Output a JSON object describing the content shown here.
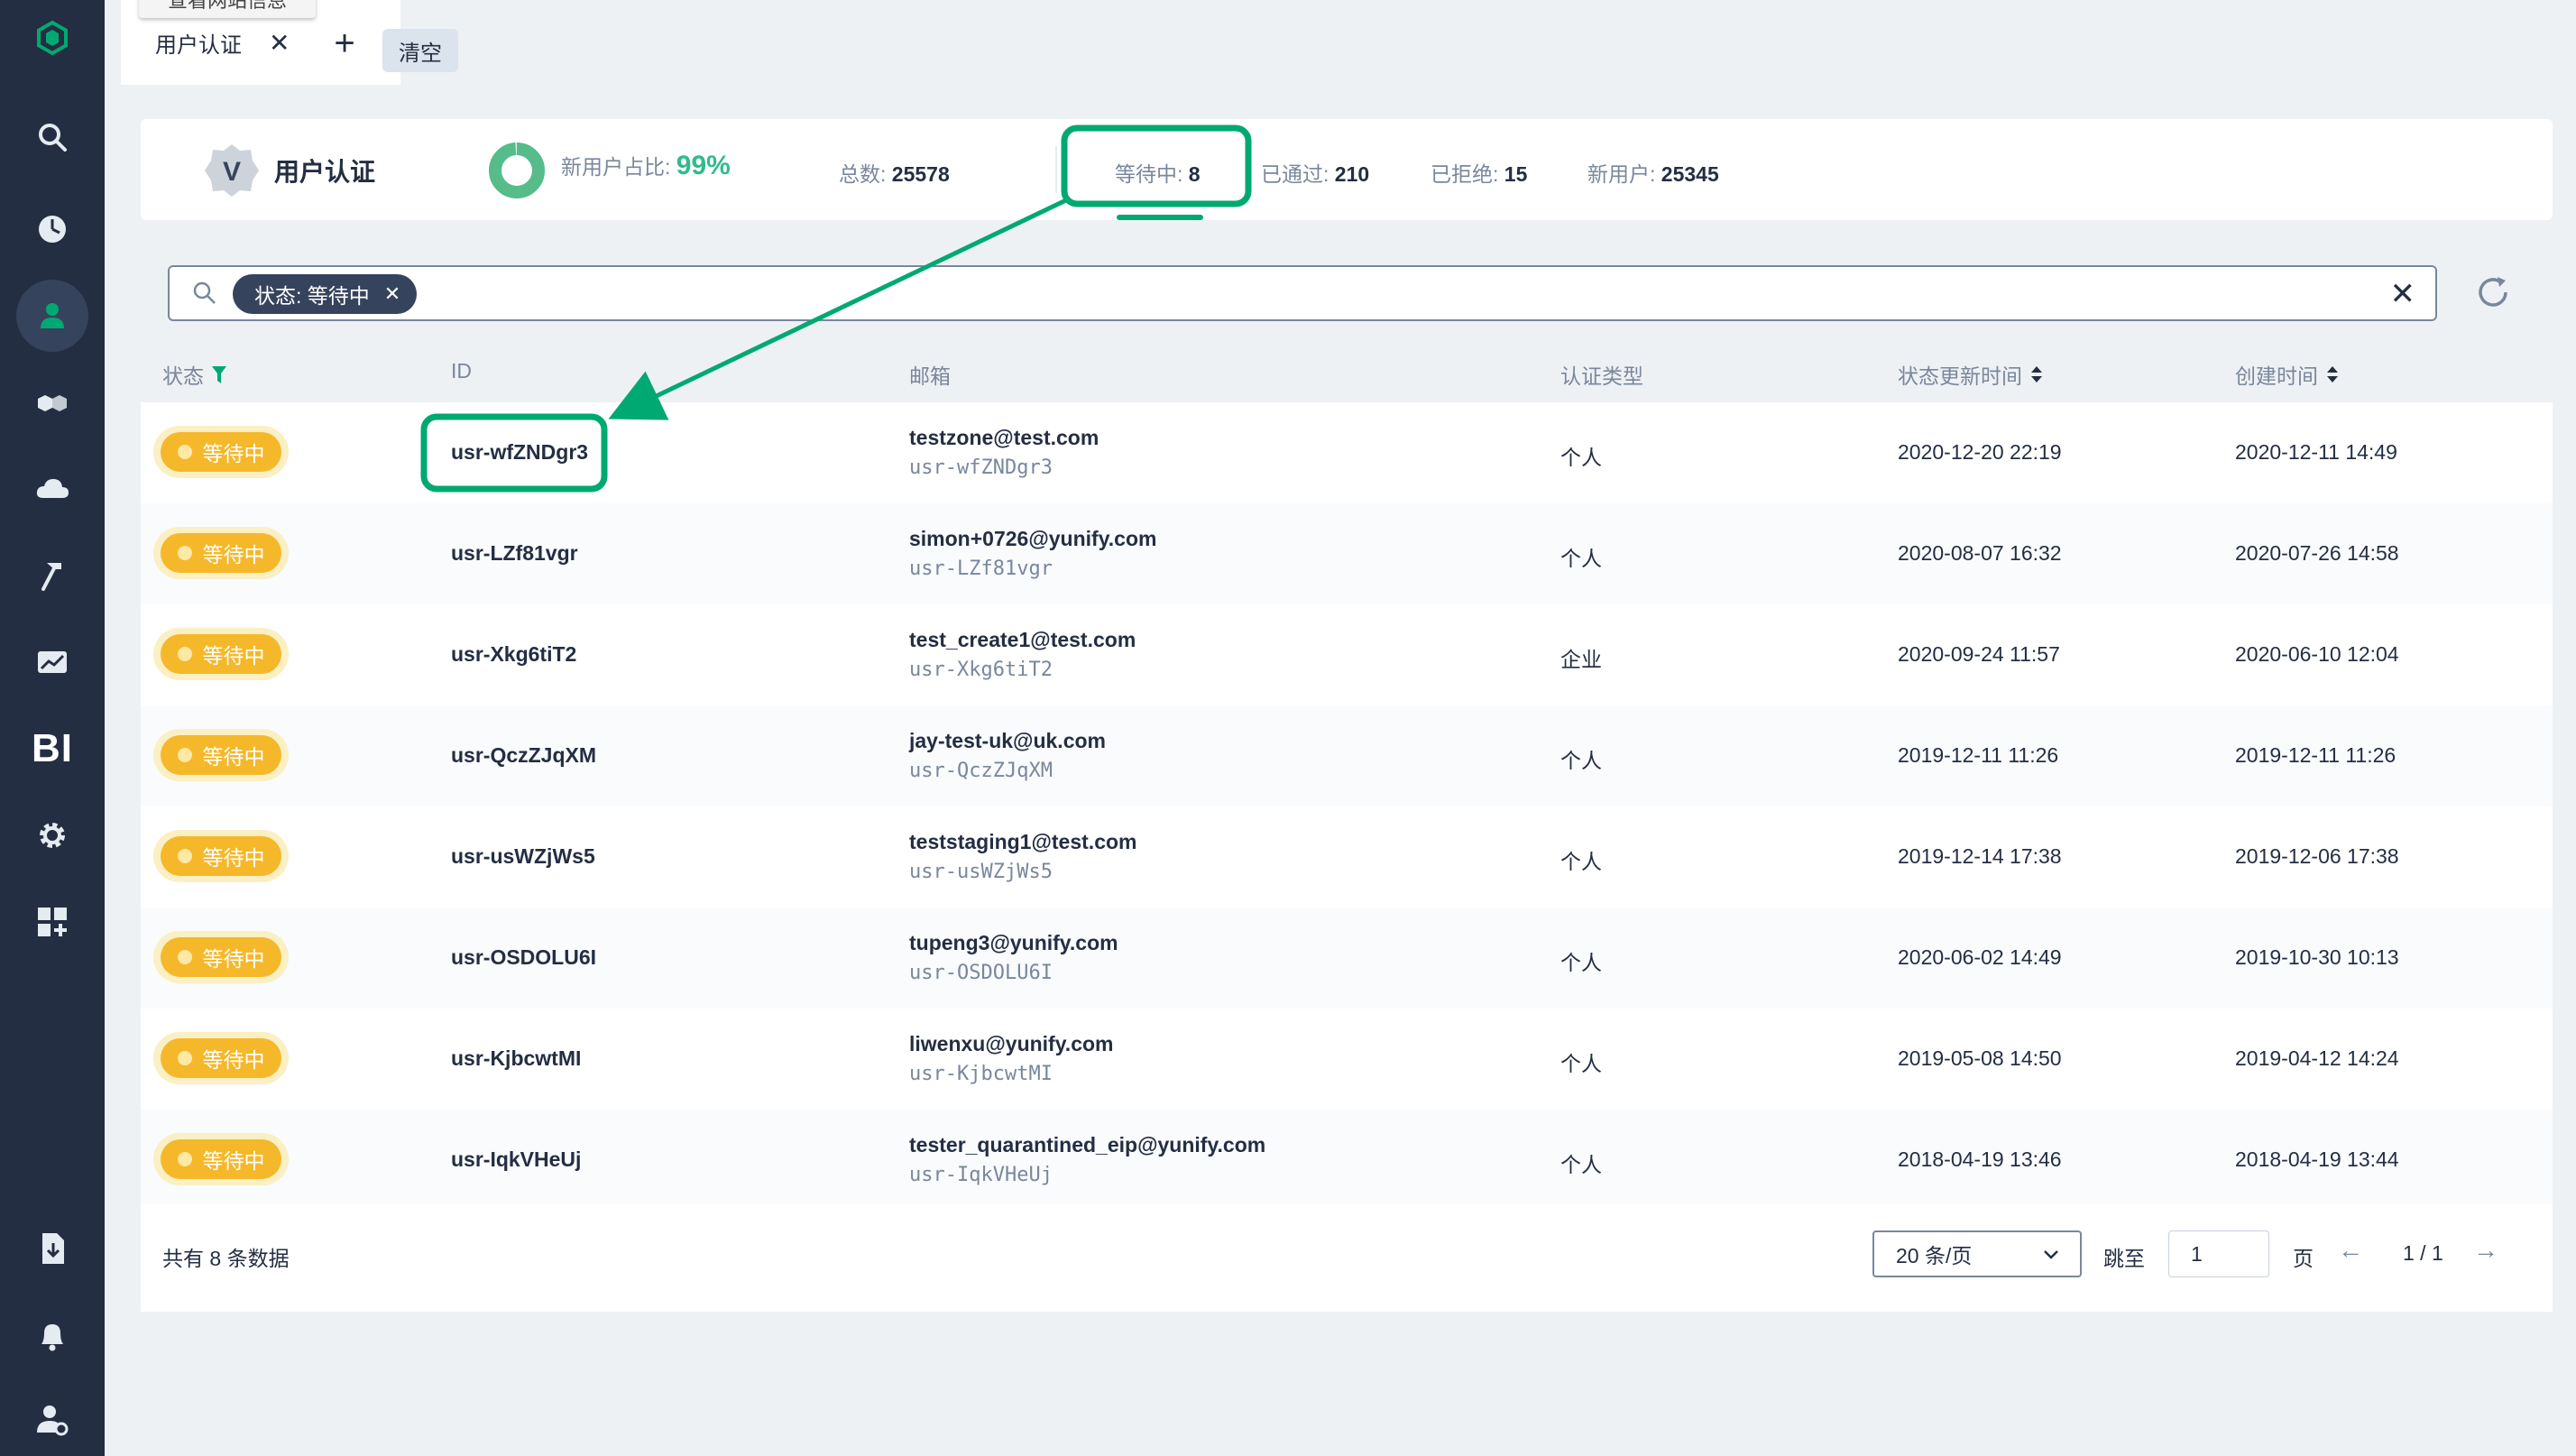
{
  "tabs": {
    "tooltip": "查看网站信息",
    "active_tab_label": "用户认证",
    "add_label": "+",
    "clear_label": "清空"
  },
  "stats": {
    "title": "用户认证",
    "brand_letter": "V",
    "new_user_ratio_label": "新用户占比:",
    "new_user_ratio_value": "99%",
    "new_user_ratio_fraction": 0.99,
    "total_label": "总数:",
    "total_value": "25578",
    "pending_label": "等待中:",
    "pending_value": "8",
    "passed_label": "已通过:",
    "passed_value": "210",
    "rejected_label": "已拒绝:",
    "rejected_value": "15",
    "new_users_label": "新用户:",
    "new_users_value": "25345"
  },
  "search": {
    "filter_tag": "状态: 等待中"
  },
  "table": {
    "columns": [
      "状态",
      "ID",
      "邮箱",
      "认证类型",
      "状态更新时间",
      "创建时间"
    ],
    "rows": [
      {
        "status": "等待中",
        "id": "usr-wfZNDgr3",
        "email": "testzone@test.com",
        "email_sub": "usr-wfZNDgr3",
        "type": "个人",
        "updated": "2020-12-20 22:19",
        "created": "2020-12-11 14:49"
      },
      {
        "status": "等待中",
        "id": "usr-LZf81vgr",
        "email": "simon+0726@yunify.com",
        "email_sub": "usr-LZf81vgr",
        "type": "个人",
        "updated": "2020-08-07 16:32",
        "created": "2020-07-26 14:58"
      },
      {
        "status": "等待中",
        "id": "usr-Xkg6tiT2",
        "email": "test_create1@test.com",
        "email_sub": "usr-Xkg6tiT2",
        "type": "企业",
        "updated": "2020-09-24 11:57",
        "created": "2020-06-10 12:04"
      },
      {
        "status": "等待中",
        "id": "usr-QczZJqXM",
        "email": "jay-test-uk@uk.com",
        "email_sub": "usr-QczZJqXM",
        "type": "个人",
        "updated": "2019-12-11 11:26",
        "created": "2019-12-11 11:26"
      },
      {
        "status": "等待中",
        "id": "usr-usWZjWs5",
        "email": "teststaging1@test.com",
        "email_sub": "usr-usWZjWs5",
        "type": "个人",
        "updated": "2019-12-14 17:38",
        "created": "2019-12-06 17:38"
      },
      {
        "status": "等待中",
        "id": "usr-OSDOLU6I",
        "email": "tupeng3@yunify.com",
        "email_sub": "usr-OSDOLU6I",
        "type": "个人",
        "updated": "2020-06-02 14:49",
        "created": "2019-10-30 10:13"
      },
      {
        "status": "等待中",
        "id": "usr-KjbcwtMI",
        "email": "liwenxu@yunify.com",
        "email_sub": "usr-KjbcwtMI",
        "type": "个人",
        "updated": "2019-05-08 14:50",
        "created": "2019-04-12 14:24"
      },
      {
        "status": "等待中",
        "id": "usr-IqkVHeUj",
        "email": "tester_quarantined_eip@yunify.com",
        "email_sub": "usr-IqkVHeUj",
        "type": "个人",
        "updated": "2018-04-19 13:46",
        "created": "2018-04-19 13:44"
      }
    ]
  },
  "footer": {
    "total_text": "共有 8 条数据",
    "page_size": "20 条/页",
    "goto_label": "跳至",
    "goto_value": "1",
    "page_label": "页",
    "page_count": "1 / 1",
    "prev": "←",
    "next": "→"
  },
  "sidebar": {
    "bi_label": "BI",
    "icons": [
      "logo-icon",
      "search-icon",
      "dashboard-icon",
      "user-icon",
      "cluster-icon",
      "cloud-icon",
      "hammer-icon",
      "chart-icon",
      "bi-icon",
      "gear-icon",
      "apps-icon",
      "download-icon",
      "bell-icon",
      "user-settings-icon"
    ]
  },
  "colors": {
    "sidebar_bg": "#242e42",
    "accent_green": "#00a971",
    "status_pending": "#f5b82a"
  }
}
